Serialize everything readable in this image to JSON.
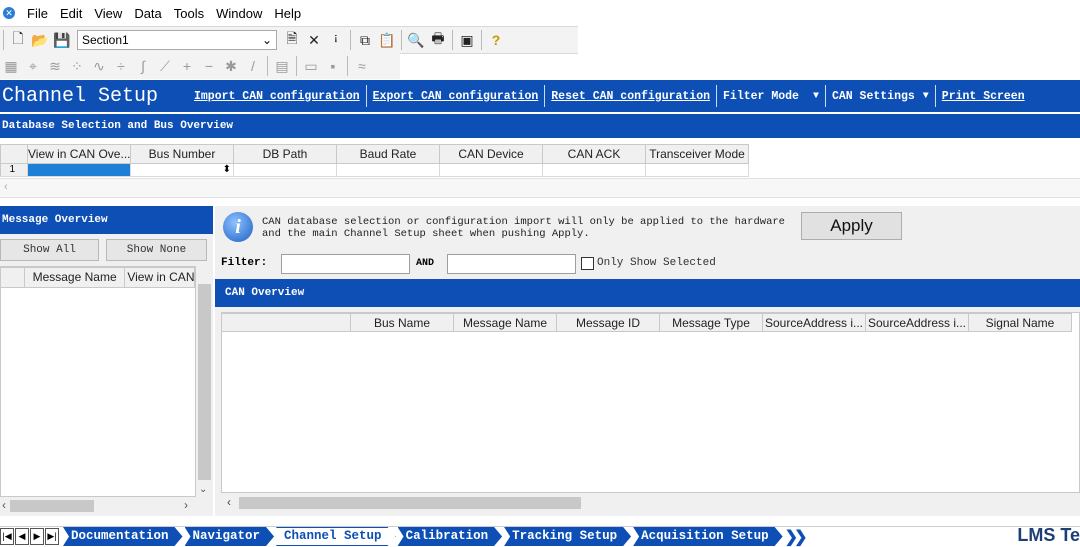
{
  "menu": [
    "File",
    "Edit",
    "View",
    "Data",
    "Tools",
    "Window",
    "Help"
  ],
  "toolbar": {
    "section_value": "Section1"
  },
  "header": {
    "title": "Channel Setup",
    "links": [
      "Import CAN configuration",
      "Export CAN configuration",
      "Reset CAN configuration"
    ],
    "filter_mode": "Filter Mode",
    "can_settings": "CAN Settings",
    "print": "Print Screen"
  },
  "db_section": {
    "title": "Database Selection and Bus Overview",
    "columns": [
      "View in CAN Ove...",
      "Bus Number",
      "DB Path",
      "Baud Rate",
      "CAN Device",
      "CAN ACK",
      "Transceiver Mode"
    ],
    "row_number": "1"
  },
  "message_overview": {
    "title": "Message Overview",
    "show_all": "Show All",
    "show_none": "Show None",
    "columns": [
      "Message Name",
      "View in CAN"
    ]
  },
  "info": {
    "text_line1": "CAN database selection or configuration import will only be applied to the hardware",
    "text_line2": "and the main Channel Setup sheet when pushing Apply.",
    "apply": "Apply"
  },
  "filter": {
    "label": "Filter:",
    "and_label": "AND",
    "only_show_selected": "Only Show Selected"
  },
  "can_overview": {
    "title": "CAN Overview",
    "columns": [
      "",
      "Bus Name",
      "Message Name",
      "Message ID",
      "Message Type",
      "SourceAddress i...",
      "SourceAddress i...",
      "Signal Name"
    ]
  },
  "tabs": [
    "Documentation",
    "Navigator",
    "Channel Setup",
    "Calibration",
    "Tracking Setup",
    "Acquisition Setup"
  ],
  "active_tab": "Channel Setup",
  "brand": "LMS Te",
  "colors": {
    "accent": "#0d4fb5",
    "selection": "#1e7fd6"
  }
}
